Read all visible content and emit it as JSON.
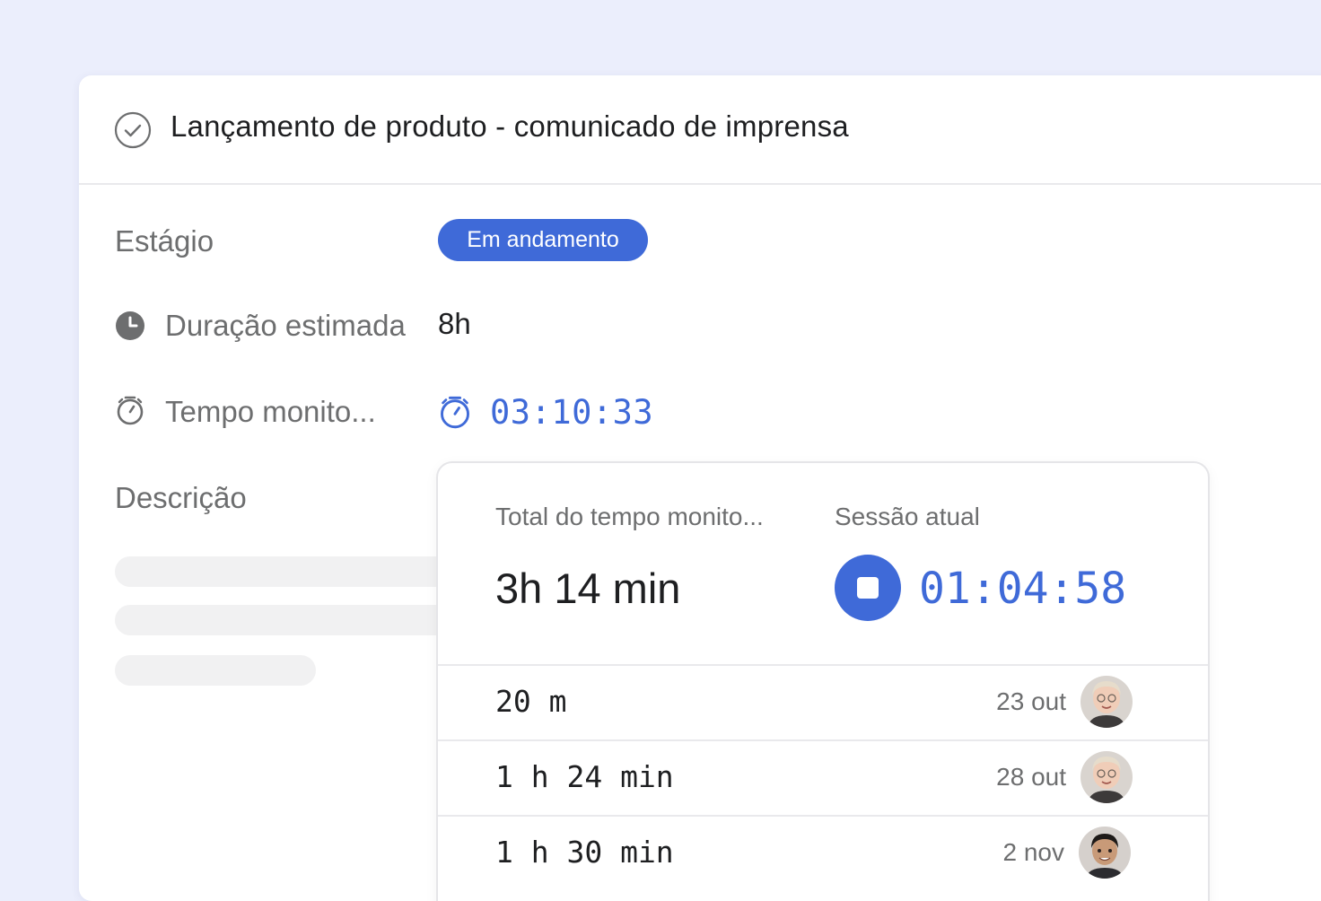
{
  "task": {
    "title": "Lançamento de produto - comunicado de imprensa"
  },
  "fields": {
    "stage_label": "Estágio",
    "stage_value": "Em andamento",
    "estimate_label": "Duração estimada",
    "estimate_value": "8h",
    "tracked_label": "Tempo monito...",
    "tracked_value": "03:10:33",
    "description_label": "Descrição"
  },
  "time_panel": {
    "total_label": "Total do tempo monito...",
    "total_value": "3h 14 min",
    "session_label": "Sessão atual",
    "session_value": "01:04:58",
    "entries": [
      {
        "duration": "20 m",
        "date": "23 out"
      },
      {
        "duration": "1 h 24 min",
        "date": "28 out"
      },
      {
        "duration": "1 h 30 min",
        "date": "2 nov"
      }
    ]
  },
  "colors": {
    "accent": "#3f6ad8",
    "background": "#ebeefc",
    "text": "#1e1f21",
    "muted": "#6d6e6f"
  },
  "icons": {
    "title": "check-circle-icon",
    "estimate": "clock-icon",
    "tracked": "stopwatch-icon",
    "stop": "stop-icon"
  }
}
